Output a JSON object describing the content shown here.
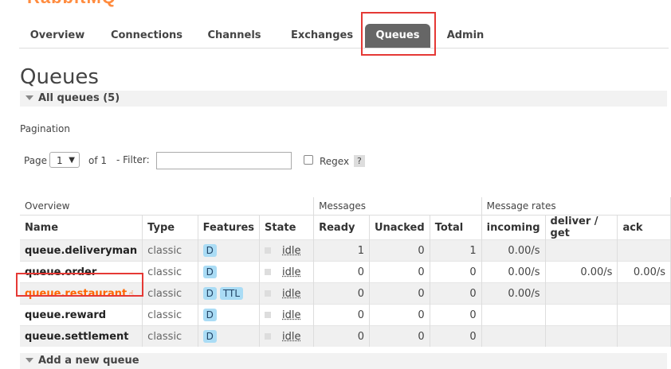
{
  "nav": {
    "tabs": [
      {
        "label": "Overview"
      },
      {
        "label": "Connections"
      },
      {
        "label": "Channels"
      },
      {
        "label": "Exchanges"
      },
      {
        "label": "Queues",
        "active": true
      },
      {
        "label": "Admin"
      }
    ]
  },
  "page": {
    "title": "Queues",
    "all_queues_label": "All queues (5)",
    "pagination_label": "Pagination",
    "page_label": "Page",
    "page_value": "1",
    "of_label": "of 1",
    "filter_label": "- Filter:",
    "filter_value": "",
    "regex_label": "Regex",
    "help_label": "?",
    "add_queue_label": "Add a new queue"
  },
  "table": {
    "group_headers": {
      "overview": "Overview",
      "messages": "Messages",
      "rates": "Message rates"
    },
    "columns": {
      "name": "Name",
      "type": "Type",
      "features": "Features",
      "state": "State",
      "ready": "Ready",
      "unacked": "Unacked",
      "total": "Total",
      "incoming": "incoming",
      "deliver": "deliver / get",
      "ack": "ack"
    },
    "rows": [
      {
        "name": "queue.deliveryman",
        "type": "classic",
        "features": [
          "D"
        ],
        "state": "idle",
        "ready": "1",
        "unacked": "0",
        "total": "1",
        "incoming": "0.00/s",
        "deliver": "",
        "ack": ""
      },
      {
        "name": "queue.order",
        "type": "classic",
        "features": [
          "D"
        ],
        "state": "idle",
        "ready": "0",
        "unacked": "0",
        "total": "0",
        "incoming": "0.00/s",
        "deliver": "0.00/s",
        "ack": "0.00/s"
      },
      {
        "name": "queue.restaurant",
        "type": "classic",
        "features": [
          "D",
          "TTL"
        ],
        "state": "idle",
        "ready": "0",
        "unacked": "0",
        "total": "0",
        "incoming": "0.00/s",
        "deliver": "",
        "ack": ""
      },
      {
        "name": "queue.reward",
        "type": "classic",
        "features": [
          "D"
        ],
        "state": "idle",
        "ready": "0",
        "unacked": "0",
        "total": "0",
        "incoming": "",
        "deliver": "",
        "ack": ""
      },
      {
        "name": "queue.settlement",
        "type": "classic",
        "features": [
          "D"
        ],
        "state": "idle",
        "ready": "0",
        "unacked": "0",
        "total": "0",
        "incoming": "",
        "deliver": "",
        "ack": ""
      }
    ]
  },
  "colors": {
    "accent": "#ff6600",
    "tab_active": "#666666",
    "highlight": "#e53935",
    "feature_badge": "#aadcf5"
  }
}
